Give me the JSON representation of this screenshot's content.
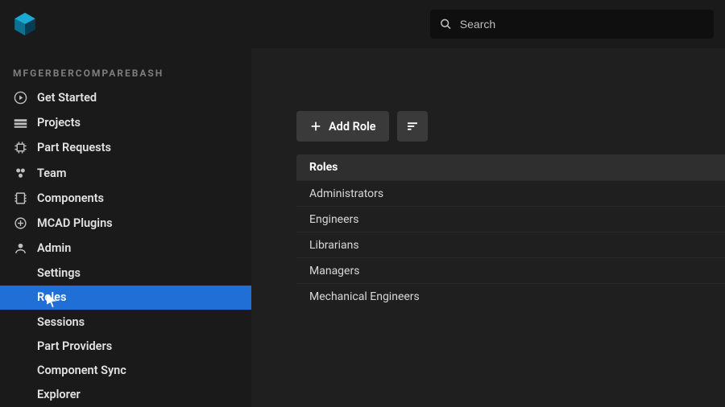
{
  "search": {
    "placeholder": "Search"
  },
  "workspace": {
    "label": "MFGERBERCOMPAREBASH"
  },
  "sidebar": {
    "items": [
      {
        "label": "Get Started"
      },
      {
        "label": "Projects"
      },
      {
        "label": "Part Requests"
      },
      {
        "label": "Team"
      },
      {
        "label": "Components"
      },
      {
        "label": "MCAD Plugins"
      },
      {
        "label": "Admin"
      }
    ],
    "admin_sub": [
      {
        "label": "Settings"
      },
      {
        "label": "Roles"
      },
      {
        "label": "Sessions"
      },
      {
        "label": "Part Providers"
      },
      {
        "label": "Component Sync"
      },
      {
        "label": "Explorer"
      }
    ]
  },
  "toolbar": {
    "add_role_label": "Add Role"
  },
  "table": {
    "header": "Roles",
    "rows": [
      "Administrators",
      "Engineers",
      "Librarians",
      "Managers",
      "Mechanical Engineers"
    ]
  }
}
